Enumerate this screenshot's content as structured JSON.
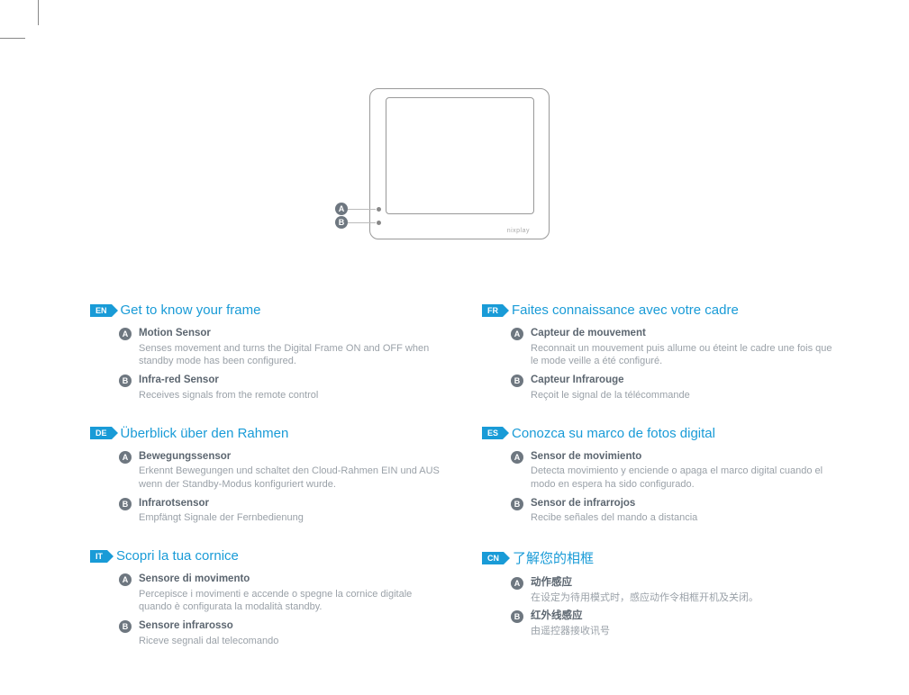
{
  "diagram": {
    "labelA": "A",
    "labelB": "B",
    "brand": "nixplay"
  },
  "left": [
    {
      "lang": "EN",
      "title": "Get to know your frame",
      "items": [
        {
          "key": "A",
          "title": "Motion Sensor",
          "desc": "Senses movement and turns the Digital Frame ON and OFF when standby mode has been configured."
        },
        {
          "key": "B",
          "title": "Infra-red Sensor",
          "desc": "Receives signals from the remote control"
        }
      ]
    },
    {
      "lang": "DE",
      "title": "Überblick über den Rahmen",
      "items": [
        {
          "key": "A",
          "title": "Bewegungssensor",
          "desc": "Erkennt Bewegungen und schaltet den Cloud-Rahmen EIN und AUS wenn der Standby-Modus konfiguriert wurde."
        },
        {
          "key": "B",
          "title": "Infrarotsensor",
          "desc": "Empfängt Signale der Fernbedienung"
        }
      ]
    },
    {
      "lang": "IT",
      "title": "Scopri la tua cornice",
      "items": [
        {
          "key": "A",
          "title": "Sensore di movimento",
          "desc": "Percepisce i movimenti e accende o spegne la cornice digitale quando è configurata la modalità standby."
        },
        {
          "key": "B",
          "title": "Sensore infrarosso",
          "desc": "Riceve segnali dal telecomando"
        }
      ]
    }
  ],
  "right": [
    {
      "lang": "FR",
      "title": "Faites connaissance avec votre cadre",
      "items": [
        {
          "key": "A",
          "title": "Capteur de mouvement",
          "desc": "Reconnait un mouvement puis allume ou éteint le cadre une fois que le mode veille a été configuré."
        },
        {
          "key": "B",
          "title": "Capteur Infrarouge",
          "desc": "Reçoit le signal de la télécommande"
        }
      ]
    },
    {
      "lang": "ES",
      "title": "Conozca su marco de fotos digital",
      "items": [
        {
          "key": "A",
          "title": "Sensor de movimiento",
          "desc": "Detecta movimiento y enciende o apaga el marco digital cuando el modo en espera ha sido configurado."
        },
        {
          "key": "B",
          "title": "Sensor de infrarrojos",
          "desc": "Recibe señales del mando a distancia"
        }
      ]
    },
    {
      "lang": "CN",
      "title": "了解您的相框",
      "items": [
        {
          "key": "A",
          "title": "动作感应",
          "desc": "在设定为待用模式时，感应动作令相框开机及关闭。"
        },
        {
          "key": "B",
          "title": "红外线感应",
          "desc": "由遥控器接收讯号"
        }
      ]
    }
  ]
}
